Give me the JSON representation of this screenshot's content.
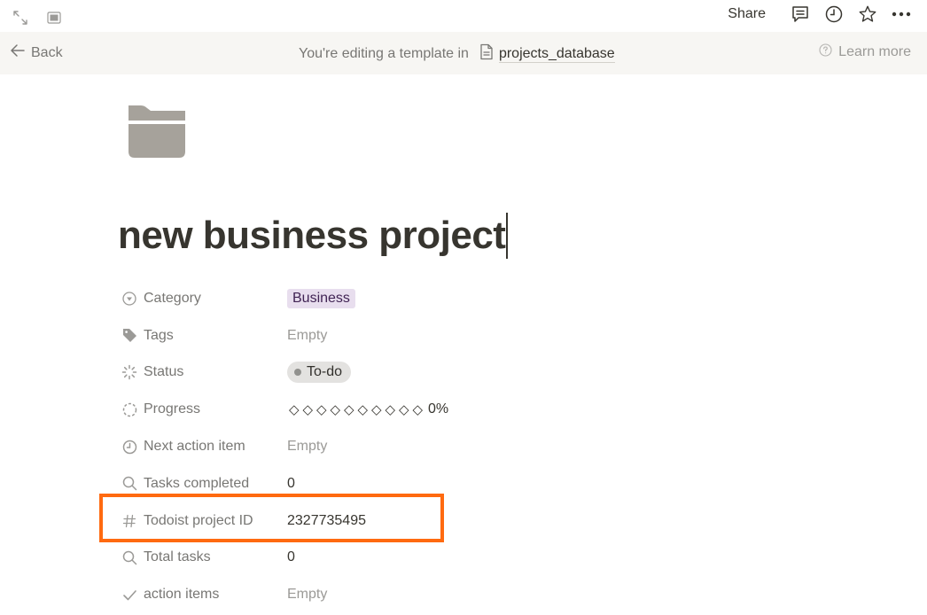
{
  "topbar": {
    "left_icons": [
      "expand-icon",
      "sidebar-peek-icon"
    ],
    "share_label": "Share",
    "right_icons": [
      "comment-icon",
      "history-clock-icon",
      "star-icon",
      "more-icon"
    ]
  },
  "banner": {
    "back_label": "Back",
    "editing_text": "You're editing a template in",
    "database_name": "projects_database",
    "learn_more_label": "Learn more"
  },
  "page": {
    "icon": "folder-icon",
    "title": "new business project"
  },
  "properties": [
    {
      "name": "Category",
      "icon": "select-icon",
      "value": "Business",
      "type": "select",
      "color": "#e8deee"
    },
    {
      "name": "Tags",
      "icon": "tag-icon",
      "value": "Empty",
      "type": "empty"
    },
    {
      "name": "Status",
      "icon": "status-icon",
      "value": "To-do",
      "type": "status",
      "color": "#e3e2e0"
    },
    {
      "name": "Progress",
      "icon": "rollup-icon",
      "value": "0%",
      "type": "progress",
      "progress_fraction": 0,
      "progress_segments": 10,
      "diamond_glyph": "◇"
    },
    {
      "name": "Next action item",
      "icon": "clock-icon",
      "value": "Empty",
      "type": "empty"
    },
    {
      "name": "Tasks completed",
      "icon": "search-icon",
      "value": "0",
      "type": "number"
    },
    {
      "name": "Todoist project ID",
      "icon": "hash-icon",
      "value": "2327735495",
      "type": "number",
      "highlighted": true
    },
    {
      "name": "Total tasks",
      "icon": "search-icon",
      "value": "0",
      "type": "number"
    },
    {
      "name": "action items",
      "icon": "check-icon",
      "value": "Empty",
      "type": "empty"
    }
  ],
  "highlight_color": "#ff6a10"
}
